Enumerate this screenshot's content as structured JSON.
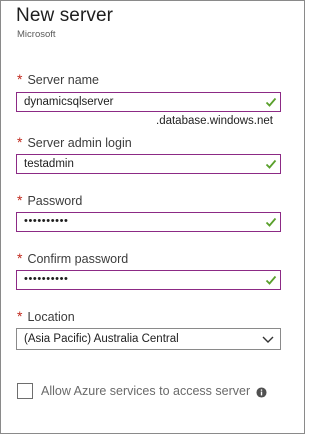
{
  "header": {
    "title": "New server",
    "subtitle": "Microsoft"
  },
  "form": {
    "server_name": {
      "label": "Server name",
      "value": "dynamicsqlserver",
      "suffix": ".database.windows.net"
    },
    "admin_login": {
      "label": "Server admin login",
      "value": "testadmin"
    },
    "password": {
      "label": "Password",
      "value": "••••••••••"
    },
    "confirm_password": {
      "label": "Confirm password",
      "value": "••••••••••"
    },
    "location": {
      "label": "Location",
      "value": "(Asia Pacific) Australia Central"
    },
    "allow_azure": {
      "label": "Allow Azure services to access server",
      "checked": false
    },
    "required_marker": "*"
  },
  "colors": {
    "required": "#c0271b",
    "valid_check": "#5aa02c",
    "field_border": "#8c2a85"
  },
  "icons": {
    "valid": "checkmark-icon",
    "dropdown": "chevron-down-icon",
    "info": "info-icon"
  }
}
